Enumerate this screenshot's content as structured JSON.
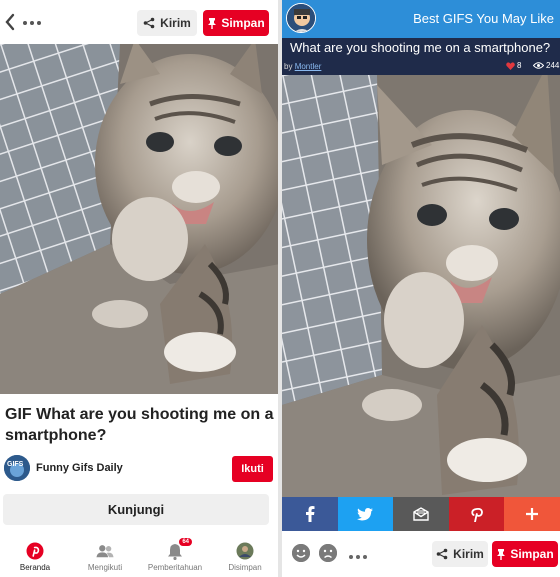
{
  "left": {
    "top_bar": {
      "back_icon": "chevron-left-icon",
      "more_icon": "more-dots-icon",
      "send_label": "Kirim",
      "save_label": "Simpan"
    },
    "pin_title": "GIF What are you shooting me on a smartphone?",
    "creator": {
      "name": "Funny Gifs Daily",
      "avatar_text": "GIFS",
      "follow_label": "Ikuti"
    },
    "visit_label": "Kunjungi",
    "bottom_nav": [
      {
        "label": "Beranda",
        "icon": "pinterest-icon",
        "active": true
      },
      {
        "label": "Mengikuti",
        "icon": "people-icon",
        "active": false
      },
      {
        "label": "Pemberitahuan",
        "icon": "bell-icon",
        "active": false,
        "badge": "64"
      },
      {
        "label": "Disimpan",
        "icon": "avatar-icon",
        "active": false
      }
    ]
  },
  "right": {
    "site_title": "Best GIFS You May Like",
    "post_title": "What are you shooting me on a smartphone?",
    "by_prefix": "by",
    "author": "Montler",
    "likes": "8",
    "views": "244",
    "share_buttons": [
      {
        "name": "facebook",
        "icon": "facebook-icon",
        "color": "#3b5998"
      },
      {
        "name": "twitter",
        "icon": "twitter-icon",
        "color": "#1da1f2"
      },
      {
        "name": "email",
        "icon": "email-icon",
        "color": "#595959"
      },
      {
        "name": "pinterest",
        "icon": "pinterest-icon",
        "color": "#cb2027"
      },
      {
        "name": "more",
        "icon": "plus-icon",
        "color": "#f0563a"
      }
    ],
    "send_label": "Kirim",
    "save_label": "Simpan"
  },
  "colors": {
    "pinterest_red": "#e60023",
    "header_blue": "#2d8ed8",
    "subbar_navy": "#1f2b4a",
    "button_gray": "#efefef"
  }
}
